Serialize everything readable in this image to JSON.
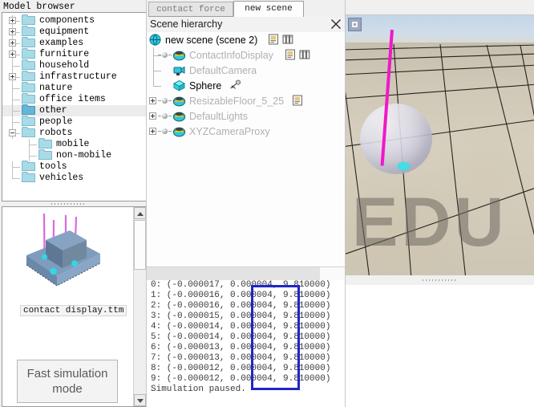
{
  "model_browser": {
    "title": "Model browser",
    "items": [
      {
        "label": "components",
        "indent": 0,
        "expander": "plus"
      },
      {
        "label": "equipment",
        "indent": 0,
        "expander": "plus"
      },
      {
        "label": "examples",
        "indent": 0,
        "expander": "plus"
      },
      {
        "label": "furniture",
        "indent": 0,
        "expander": "plus"
      },
      {
        "label": "household",
        "indent": 0,
        "expander": "none"
      },
      {
        "label": "infrastructure",
        "indent": 0,
        "expander": "plus"
      },
      {
        "label": "nature",
        "indent": 0,
        "expander": "none"
      },
      {
        "label": "office items",
        "indent": 0,
        "expander": "none"
      },
      {
        "label": "other",
        "indent": 0,
        "expander": "none",
        "selected": true
      },
      {
        "label": "people",
        "indent": 0,
        "expander": "none"
      },
      {
        "label": "robots",
        "indent": 0,
        "expander": "minus"
      },
      {
        "label": "mobile",
        "indent": 1,
        "expander": "none"
      },
      {
        "label": "non-mobile",
        "indent": 1,
        "expander": "none"
      },
      {
        "label": "tools",
        "indent": 0,
        "expander": "none"
      },
      {
        "label": "vehicles",
        "indent": 0,
        "expander": "none"
      }
    ]
  },
  "preview": {
    "model_name": "contact display.ttm",
    "fast_mode_label": "Fast simulation mode"
  },
  "tabs": [
    {
      "label": "contact force",
      "active": false
    },
    {
      "label": "new scene",
      "active": true
    }
  ],
  "scene_hierarchy": {
    "title": "Scene hierarchy",
    "close_icon": "close-icon",
    "items": [
      {
        "label": "new scene (scene 2)",
        "indent": 0,
        "expander": "none",
        "icon": "scene-globe-icon",
        "dimmed": false,
        "extra_icons": [
          "script-icon",
          "page-stack-icon"
        ]
      },
      {
        "label": "ContactInfoDisplay",
        "indent": 1,
        "expander": "none",
        "icon": "object-sphere-icon",
        "dimmed": true,
        "extra_icons": [
          "script-icon",
          "page-stack-icon"
        ],
        "dot": true
      },
      {
        "label": "DefaultCamera",
        "indent": 1,
        "expander": "none",
        "icon": "camera-icon",
        "dimmed": true,
        "extra_icons": []
      },
      {
        "label": "Sphere",
        "indent": 1,
        "expander": "none",
        "icon": "primitive-cube-icon",
        "dimmed": false,
        "extra_icons": [
          "dynamics-icon"
        ]
      },
      {
        "label": "ResizableFloor_5_25",
        "indent": 0,
        "expander": "plus",
        "icon": "object-sphere-icon",
        "dimmed": true,
        "extra_icons": [
          "script-icon"
        ],
        "dot": true
      },
      {
        "label": "DefaultLights",
        "indent": 0,
        "expander": "plus",
        "icon": "object-sphere-icon",
        "dimmed": true,
        "extra_icons": [],
        "dot": true
      },
      {
        "label": "XYZCameraProxy",
        "indent": 0,
        "expander": "plus",
        "icon": "object-sphere-icon",
        "dimmed": true,
        "extra_icons": [],
        "dot": true
      }
    ]
  },
  "console": {
    "lines": [
      "0: (-0.000017, 0.000004, 9.810000)",
      "1: (-0.000016, 0.000004, 9.810000)",
      "2: (-0.000016, 0.000004, 9.810000)",
      "3: (-0.000015, 0.000004, 9.810000)",
      "4: (-0.000014, 0.000004, 9.810000)",
      "5: (-0.000014, 0.000004, 9.810000)",
      "6: (-0.000013, 0.000004, 9.810000)",
      "7: (-0.000013, 0.000004, 9.810000)",
      "8: (-0.000012, 0.000004, 9.810000)",
      "9: (-0.000012, 0.000004, 9.810000)",
      "Simulation paused."
    ],
    "highlight_color": "#2026c8"
  },
  "viewport": {
    "watermark": "EDU",
    "view_button_icon": "view-square-icon"
  },
  "colors": {
    "accent_magenta": "#f018c8",
    "accent_cyan": "#3fe0e8",
    "highlight_blue": "#2026c8",
    "folder_blue": "#a8dbe8"
  }
}
